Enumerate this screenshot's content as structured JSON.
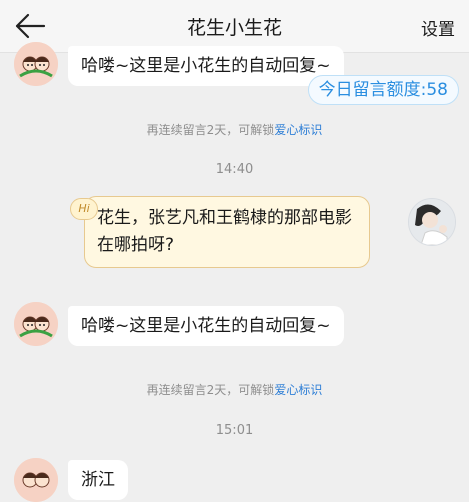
{
  "header": {
    "title": "花生小生花",
    "settings_label": "设置"
  },
  "quota": {
    "text": "今日留言额度:58"
  },
  "messages": {
    "bot_reply_1": "哈喽~这里是小花生的自动回复~",
    "notice_1_prefix": "再连续留言2天，可解锁",
    "notice_1_link": "爱心标识",
    "time_1": "14:40",
    "hi_badge": "Hi",
    "user_message": "花生，张艺凡和王鹤棣的那部电影在哪拍呀?",
    "bot_reply_2": "哈喽~这里是小花生的自动回复~",
    "notice_2_prefix": "再连续留言2天，可解锁",
    "notice_2_link": "爱心标识",
    "time_2": "15:01",
    "bot_reply_3": "浙江"
  },
  "icons": {
    "back": "back-arrow-icon",
    "bot_avatar": "cartoon-couple-avatar",
    "user_avatar": "user-photo-avatar"
  },
  "colors": {
    "background": "#efefef",
    "link": "#2f7fd6",
    "quota": "#2a8ee0",
    "user_bubble": "#fff8e1",
    "user_bubble_border": "#e7c98f"
  }
}
